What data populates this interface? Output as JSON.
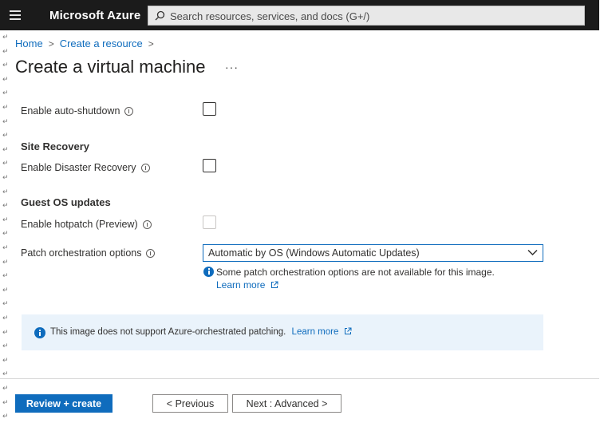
{
  "header": {
    "brand": "Microsoft Azure",
    "search_placeholder": "Search resources, services, and docs (G+/)"
  },
  "breadcrumb": {
    "items": [
      "Home",
      "Create a resource"
    ],
    "separator": ">"
  },
  "page": {
    "title": "Create a virtual machine",
    "more": "···"
  },
  "form": {
    "auto_shutdown": {
      "label": "Enable auto-shutdown",
      "checked": false
    },
    "site_recovery": {
      "heading": "Site Recovery",
      "label": "Enable Disaster Recovery",
      "checked": false
    },
    "guest_os": {
      "heading": "Guest OS updates",
      "hotpatch_label": "Enable hotpatch (Preview)",
      "hotpatch_disabled": true,
      "patch_label": "Patch orchestration options",
      "patch_value": "Automatic by OS (Windows Automatic Updates)",
      "note_text": "Some patch orchestration options are not available for this image.",
      "note_link": "Learn more"
    }
  },
  "banner": {
    "text": "This image does not support Azure-orchestrated patching.",
    "link": "Learn more"
  },
  "footer": {
    "review_create": "Review + create",
    "previous": "< Previous",
    "next": "Next : Advanced >"
  },
  "colors": {
    "accent": "#0f6cbd",
    "topbar": "#1b1b1b",
    "banner_bg": "#eaf3fb"
  },
  "icons": {
    "menu": "hamburger-icon",
    "search": "search-icon",
    "info": "info-icon",
    "chevron": "chevron-down-icon",
    "external": "external-link-icon"
  }
}
